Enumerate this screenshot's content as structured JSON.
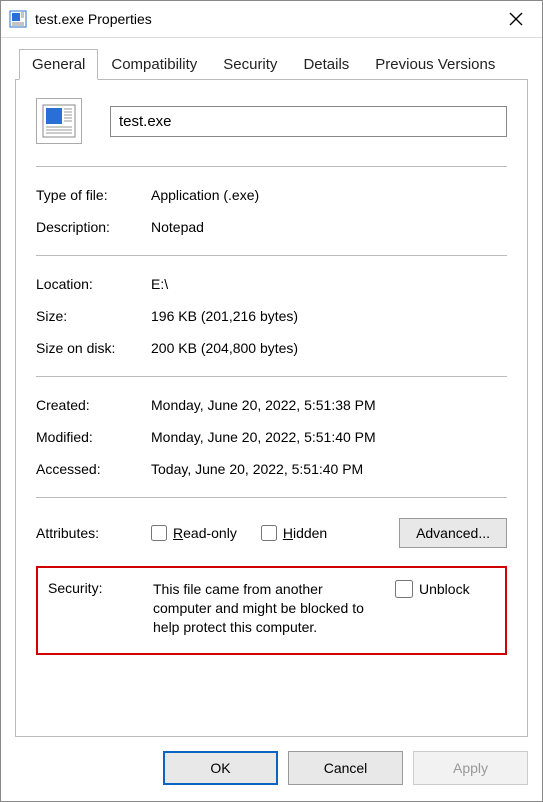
{
  "window": {
    "title": "test.exe Properties"
  },
  "tabs": {
    "t0": "General",
    "t1": "Compatibility",
    "t2": "Security",
    "t3": "Details",
    "t4": "Previous Versions"
  },
  "general": {
    "filename": "test.exe",
    "fields": {
      "type_label": "Type of file:",
      "type_value": "Application (.exe)",
      "desc_label": "Description:",
      "desc_value": "Notepad",
      "loc_label": "Location:",
      "loc_value": "E:\\",
      "size_label": "Size:",
      "size_value": "196 KB (201,216 bytes)",
      "disk_label": "Size on disk:",
      "disk_value": "200 KB (204,800 bytes)",
      "created_label": "Created:",
      "created_value": "Monday, June 20, 2022, 5:51:38 PM",
      "modified_label": "Modified:",
      "modified_value": "Monday, June 20, 2022, 5:51:40 PM",
      "accessed_label": "Accessed:",
      "accessed_value": "Today, June 20, 2022, 5:51:40 PM"
    },
    "attributes": {
      "label": "Attributes:",
      "readonly": "ead-only",
      "readonly_accel": "R",
      "hidden": "idden",
      "hidden_accel": "H",
      "advanced": "Advanced..."
    },
    "security": {
      "label": "Security:",
      "text": "This file came from another computer and might be blocked to help protect this computer.",
      "unblock": "Unbloc",
      "unblock_accel": "k"
    }
  },
  "buttons": {
    "ok": "OK",
    "cancel": "Cancel",
    "apply": "Apply"
  }
}
